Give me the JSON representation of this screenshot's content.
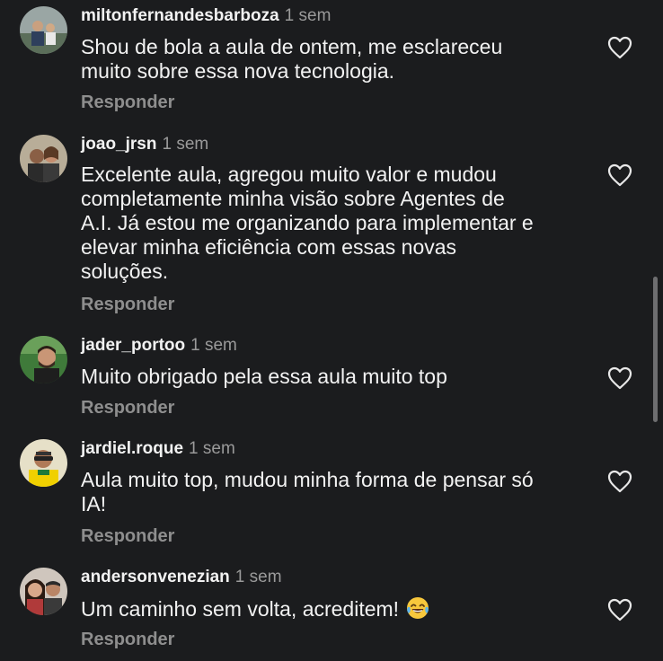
{
  "comments": [
    {
      "username": "miltonfernandesbarboza",
      "time": "1 sem",
      "text_lines": [
        "Shou de bola a aula de ontem, me esclareceu",
        "muito sobre essa nova tecnologia."
      ],
      "reply_label": "Responder"
    },
    {
      "username": "joao_jrsn",
      "time": "1 sem",
      "text_lines": [
        "Excelente aula, agregou muito valor e mudou",
        "completamente minha visão sobre Agentes de",
        "A.I. Já estou me organizando para implementar e",
        "elevar minha eficiência com essas novas",
        "soluções."
      ],
      "reply_label": "Responder"
    },
    {
      "username": "jader_portoo",
      "time": "1 sem",
      "text_lines": [
        "Muito obrigado pela essa aula muito top"
      ],
      "reply_label": "Responder"
    },
    {
      "username": "jardiel.roque",
      "time": "1 sem",
      "text_lines": [
        "Aula muito top, mudou minha forma de pensar só",
        "IA!"
      ],
      "reply_label": "Responder"
    },
    {
      "username": "andersonvenezian",
      "time": "1 sem",
      "text_lines": [
        "Um caminho sem volta, acreditem!"
      ],
      "reply_label": "Responder",
      "emoji": "tears-of-joy-emoji"
    }
  ],
  "icons": {
    "like": "heart-outline-icon"
  },
  "colors": {
    "background": "#1b1c1e",
    "text": "#f2f2f2",
    "muted": "#8e8e8e"
  }
}
